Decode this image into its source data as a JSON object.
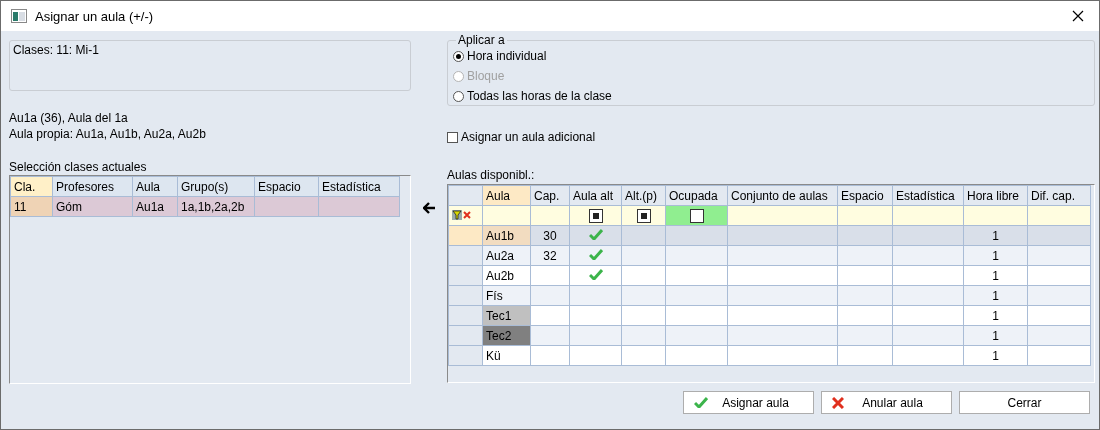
{
  "window": {
    "title": "Asignar un aula (+/-)"
  },
  "class_info": "Clases: 11: Mi-1",
  "room_info": [
    "Au1a (36), Aula del 1a",
    "Aula propia: Au1a, Au1b, Au2a, Au2b"
  ],
  "current": {
    "label": "Selección clases actuales",
    "columns": [
      "Cla.",
      "Profesores",
      "Aula",
      "Grupo(s)",
      "Espacio",
      "Estadística"
    ],
    "rows": [
      {
        "cla": "11",
        "profesores": "Góm",
        "aula": "Au1a",
        "grupos": "1a,1b,2a,2b"
      }
    ]
  },
  "apply_to": {
    "label": "Aplicar a",
    "options": [
      {
        "label": "Hora individual",
        "selected": true,
        "disabled": false
      },
      {
        "label": "Bloque",
        "selected": false,
        "disabled": true
      },
      {
        "label": "Todas las horas de la clase",
        "selected": false,
        "disabled": false
      }
    ]
  },
  "additional": {
    "label": "Asignar un aula adicional",
    "checked": false
  },
  "rooms": {
    "label": "Aulas disponibl.:",
    "columns": [
      "Aula",
      "Cap.",
      "Aula alt",
      "Alt.(p)",
      "Ocupada",
      "Conjunto de aulas",
      "Espacio",
      "Estadística",
      "Hora libre",
      "Dif. cap."
    ],
    "filters": {
      "aula_alt": true,
      "alt_p": true,
      "ocupada": false
    },
    "rows": [
      {
        "aula": "Au1b",
        "cap": "30",
        "aula_alt": true,
        "hora_libre": "1",
        "selected": true
      },
      {
        "aula": "Au2a",
        "cap": "32",
        "aula_alt": true,
        "hora_libre": "1",
        "selected": false
      },
      {
        "aula": "Au2b",
        "aula_alt": true,
        "hora_libre": "1",
        "selected": false
      },
      {
        "aula": "Fís",
        "aula_alt": false,
        "hora_libre": "1",
        "selected": false
      },
      {
        "aula": "Tec1",
        "color": "#c0c0c0",
        "aula_alt": false,
        "hora_libre": "1",
        "selected": false
      },
      {
        "aula": "Tec2",
        "color": "#808080",
        "aula_alt": false,
        "hora_libre": "1",
        "selected": false
      },
      {
        "aula": "Kü",
        "aula_alt": false,
        "hora_libre": "1",
        "selected": false
      }
    ]
  },
  "buttons": [
    {
      "label": "Asignar aula",
      "kind": "assign"
    },
    {
      "label": "Anular aula",
      "kind": "cancel"
    },
    {
      "label": "Cerrar",
      "kind": "plain"
    }
  ]
}
